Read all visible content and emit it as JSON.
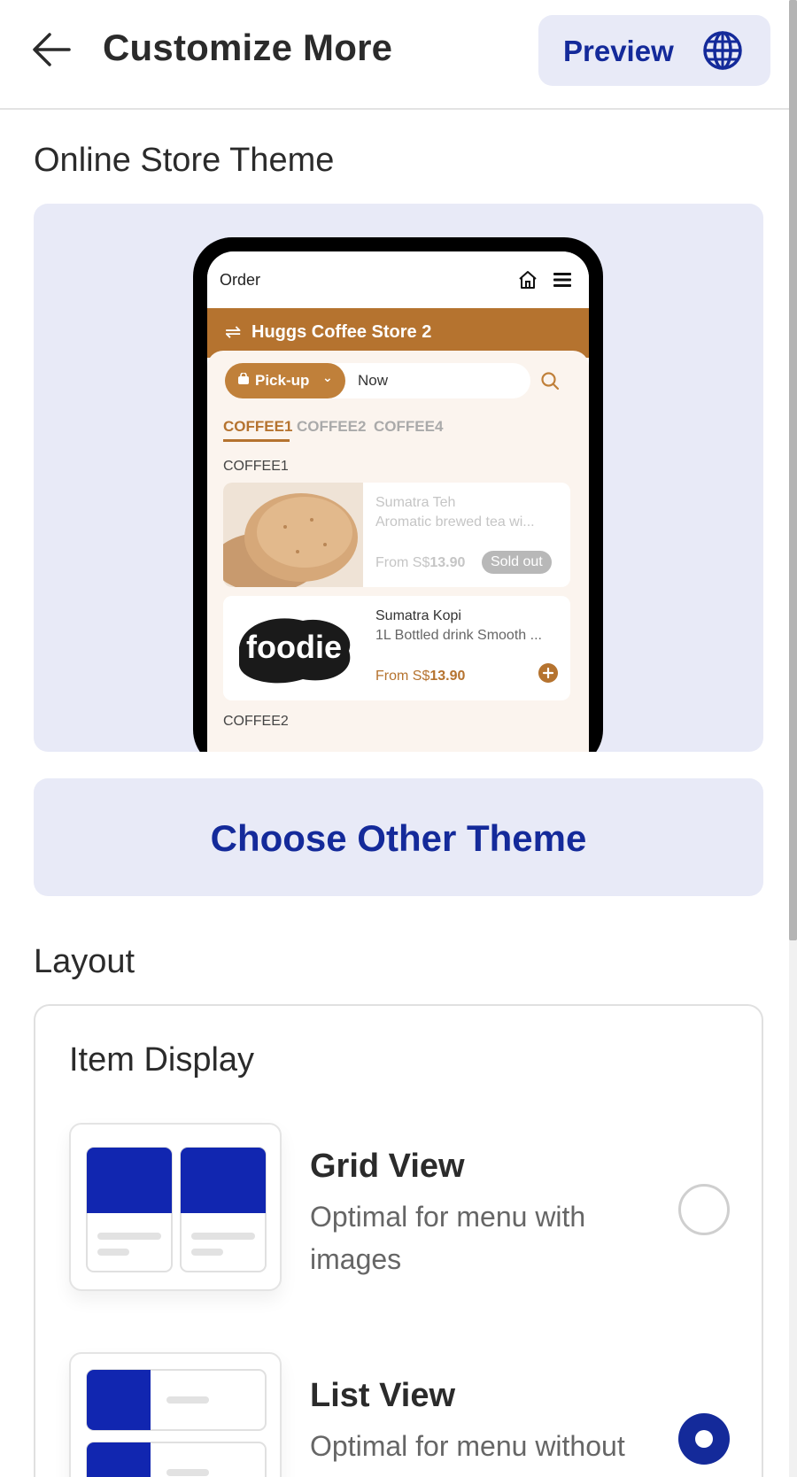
{
  "header": {
    "title": "Customize More",
    "preview_label": "Preview"
  },
  "theme_section": {
    "title": "Online Store Theme",
    "preview": {
      "app_bar_title": "Order",
      "store_name": "Huggs Coffee Store 2",
      "order_type": "Pick-up",
      "time": "Now",
      "tabs": [
        "COFFEE1",
        "COFFEE2",
        "COFFEE4"
      ],
      "active_tab": "COFFEE1",
      "categories": [
        "COFFEE1",
        "COFFEE2"
      ],
      "items": [
        {
          "name": "Sumatra Teh",
          "desc": "Aromatic brewed tea wi...",
          "price_prefix": "From S$",
          "price": "13.90",
          "badge": "Sold out"
        },
        {
          "name": "Sumatra Kopi",
          "desc": "1L Bottled drink Smooth ...",
          "price_prefix": "From S$",
          "price": "13.90",
          "logo_text": "foodie"
        }
      ]
    },
    "choose_button": "Choose Other Theme"
  },
  "layout_section": {
    "title": "Layout",
    "card_title": "Item Display",
    "options": [
      {
        "title": "Grid View",
        "desc": "Optimal for menu with images",
        "selected": false
      },
      {
        "title": "List View",
        "desc": "Optimal for menu without images",
        "selected": true
      }
    ]
  },
  "colors": {
    "primary": "#142a9a",
    "accent_bg": "#e8eaf7",
    "store_brown": "#b5732f"
  }
}
